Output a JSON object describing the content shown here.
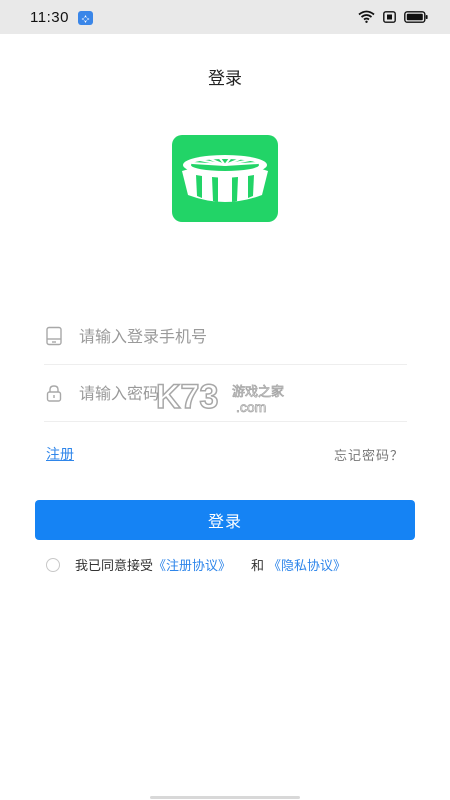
{
  "status_bar": {
    "time": "11:30",
    "icons": [
      "notification-icon",
      "wifi-icon",
      "sim-icon",
      "battery-icon"
    ]
  },
  "header": {
    "title": "登录"
  },
  "logo": {
    "icon": "app-logo-icon",
    "color": "#22d467"
  },
  "form": {
    "phone": {
      "icon": "phone-icon",
      "placeholder": "请输入登录手机号",
      "value": ""
    },
    "password": {
      "icon": "lock-icon",
      "placeholder": "请输入密码",
      "value": ""
    }
  },
  "watermark": {
    "main": "K73",
    "sub": "游戏之家",
    "domain": ".com"
  },
  "links": {
    "register": "注册",
    "forgot_password": "忘记密码？"
  },
  "login_button": {
    "label": "登录",
    "color": "#1583f4"
  },
  "agreement": {
    "prefix": "我已同意接受",
    "register_agreement": "《注册协议》",
    "and": "和",
    "privacy_agreement": "《隐私协议》"
  },
  "colors": {
    "accent": "#1583f4",
    "link": "#2f86ea"
  }
}
